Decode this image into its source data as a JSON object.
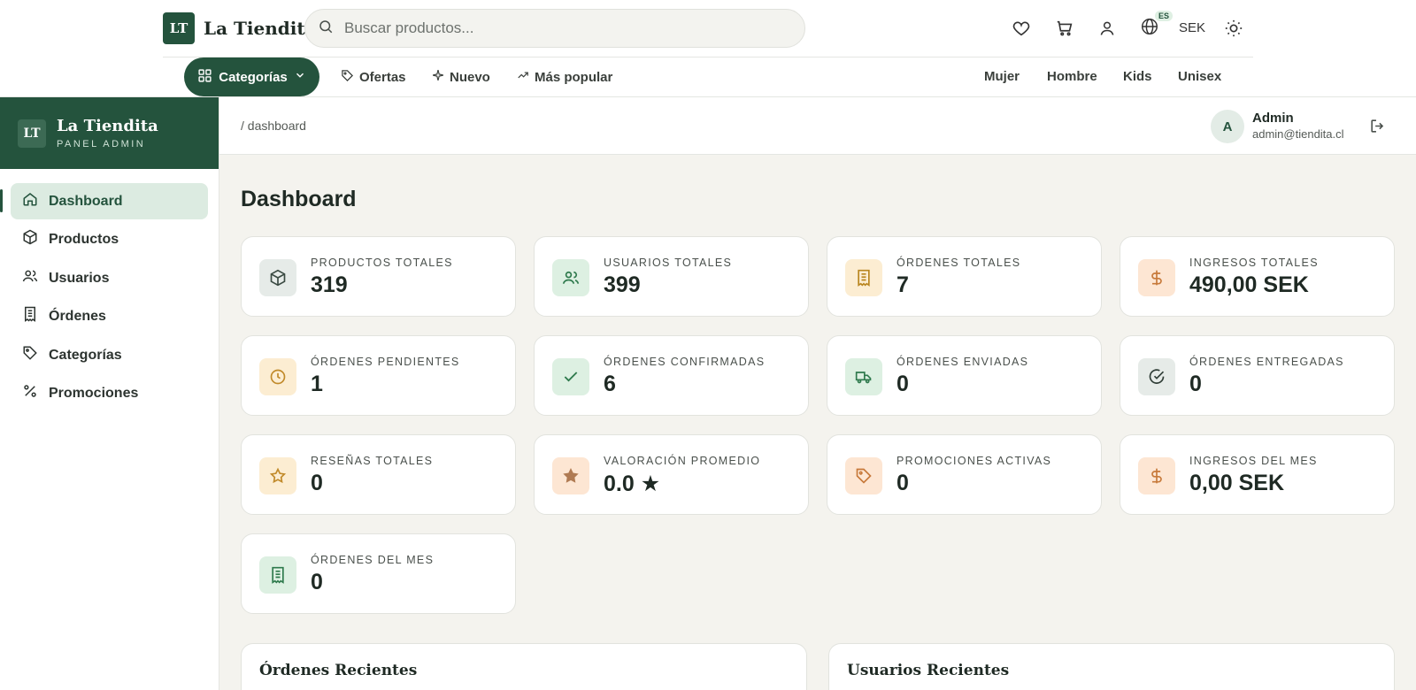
{
  "brand": {
    "logo": "LT",
    "name": "La Tiendita"
  },
  "search": {
    "placeholder": "Buscar productos..."
  },
  "header": {
    "lang_badge": "ES",
    "currency": "SEK"
  },
  "nav": {
    "categories_label": "Categorías",
    "links": [
      {
        "label": "Ofertas",
        "icon": "tag-icon"
      },
      {
        "label": "Nuevo",
        "icon": "sparkle-icon"
      },
      {
        "label": "Más popular",
        "icon": "trending-icon"
      }
    ],
    "right": [
      "Mujer",
      "Hombre",
      "Kids",
      "Unisex"
    ]
  },
  "sidebar": {
    "logo": "LT",
    "title": "La Tiendita",
    "subtitle": "PANEL ADMIN",
    "items": [
      {
        "label": "Dashboard",
        "icon": "home-icon",
        "active": true
      },
      {
        "label": "Productos",
        "icon": "box-icon"
      },
      {
        "label": "Usuarios",
        "icon": "users-icon"
      },
      {
        "label": "Órdenes",
        "icon": "receipt-icon"
      },
      {
        "label": "Categorías",
        "icon": "tag-icon"
      },
      {
        "label": "Promociones",
        "icon": "percent-icon"
      }
    ]
  },
  "topbar": {
    "breadcrumb": "/ dashboard",
    "avatar": "A",
    "admin_name": "Admin",
    "admin_email": "admin@tiendita.cl"
  },
  "page": {
    "title": "Dashboard"
  },
  "stats": [
    {
      "label": "Productos totales",
      "value": "319",
      "icon": "box-icon",
      "tone": "gray"
    },
    {
      "label": "Usuarios totales",
      "value": "399",
      "icon": "users-icon",
      "tone": "green"
    },
    {
      "label": "Órdenes totales",
      "value": "7",
      "icon": "receipt-icon",
      "tone": "amber"
    },
    {
      "label": "Ingresos totales",
      "value": "490,00 SEK",
      "icon": "dollar-icon",
      "tone": "orange"
    },
    {
      "label": "Órdenes pendientes",
      "value": "1",
      "icon": "clock-icon",
      "tone": "amber"
    },
    {
      "label": "Órdenes confirmadas",
      "value": "6",
      "icon": "check-icon",
      "tone": "green"
    },
    {
      "label": "Órdenes enviadas",
      "value": "0",
      "icon": "truck-icon",
      "tone": "green"
    },
    {
      "label": "Órdenes entregadas",
      "value": "0",
      "icon": "check-circle-icon",
      "tone": "gray"
    },
    {
      "label": "Reseñas totales",
      "value": "0",
      "icon": "star-icon",
      "tone": "amber"
    },
    {
      "label": "Valoración promedio",
      "value": "0.0 ★",
      "icon": "star-filled-icon",
      "tone": "orange"
    },
    {
      "label": "Promociones activas",
      "value": "0",
      "icon": "tag-icon",
      "tone": "orange"
    },
    {
      "label": "Ingresos del mes",
      "value": "0,00 SEK",
      "icon": "dollar-icon",
      "tone": "orange"
    },
    {
      "label": "Órdenes del mes",
      "value": "0",
      "icon": "receipt-icon",
      "tone": "green"
    }
  ],
  "panels": {
    "recent_orders": "Órdenes Recientes",
    "recent_users": "Usuarios Recientes"
  }
}
